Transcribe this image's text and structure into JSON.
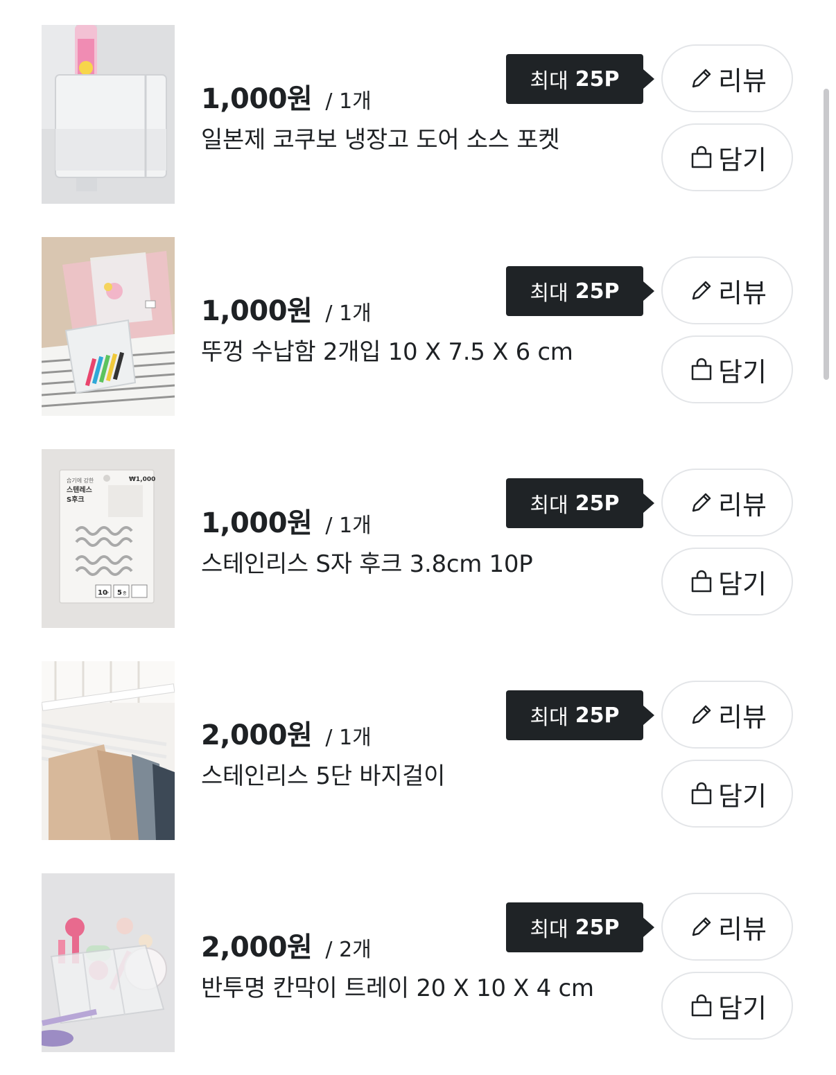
{
  "colors": {
    "badge_bg": "#1f2326",
    "badge_text": "#ffffff",
    "pill_border": "#e3e5e8",
    "text": "#1e2124"
  },
  "icons": {
    "review": "pencil-icon",
    "cart": "shopping-bag-icon"
  },
  "items": [
    {
      "price": "1,000원",
      "qty": "/ 1개",
      "name": "일본제 코쿠보 냉장고 도어 소스 포켓",
      "badge_prefix": "최대",
      "badge_points": "25P",
      "review_label": "리뷰",
      "cart_label": "담기",
      "image": "fridge-door-pocket-photo"
    },
    {
      "price": "1,000원",
      "qty": "/ 1개",
      "name": "뚜껑 수납함 2개입 10 X 7.5 X 6 cm",
      "badge_prefix": "최대",
      "badge_points": "25P",
      "review_label": "리뷰",
      "cart_label": "담기",
      "image": "lidded-storage-box-photo"
    },
    {
      "price": "1,000원",
      "qty": "/ 1개",
      "name": "스테인리스 S자 후크 3.8cm 10P",
      "badge_prefix": "최대",
      "badge_points": "25P",
      "review_label": "리뷰",
      "cart_label": "담기",
      "image": "s-hook-package-photo",
      "image_text": {
        "line1": "습기에 강한",
        "line2": "스텐레스",
        "line3": "S후크",
        "price_tag": "₩1,000",
        "count": "10",
        "count_unit": "P",
        "size": "5",
        "size_unit": "종"
      }
    },
    {
      "price": "2,000원",
      "qty": "/ 1개",
      "name": "스테인리스 5단 바지걸이",
      "badge_prefix": "최대",
      "badge_points": "25P",
      "review_label": "리뷰",
      "cart_label": "담기",
      "image": "pants-hanger-photo"
    },
    {
      "price": "2,000원",
      "qty": "/ 2개",
      "name": "반투명 칸막이 트레이 20 X 10 X 4 cm",
      "badge_prefix": "최대",
      "badge_points": "25P",
      "review_label": "리뷰",
      "cart_label": "담기",
      "image": "divider-tray-photo"
    }
  ]
}
